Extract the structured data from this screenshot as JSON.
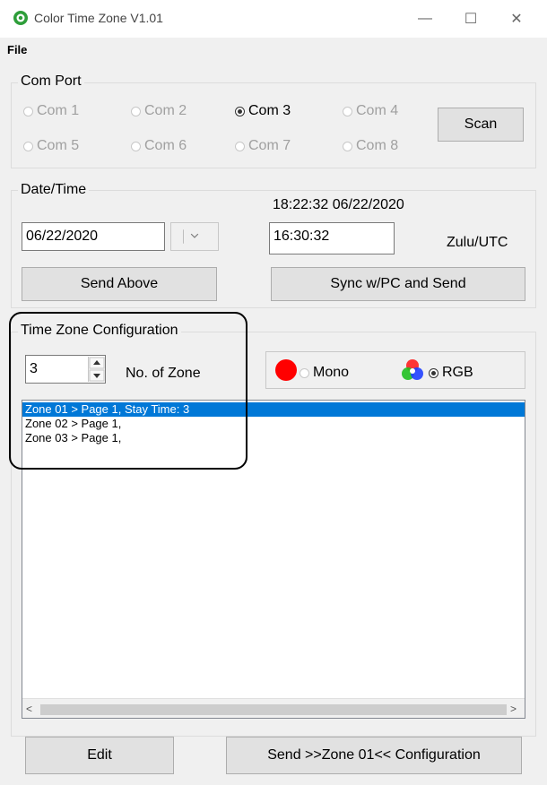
{
  "window": {
    "title": "Color Time Zone V1.01",
    "minimize_glyph": "—",
    "maximize_glyph": "☐",
    "close_glyph": "✕"
  },
  "menu": {
    "file": "File"
  },
  "com_port": {
    "title": "Com Port",
    "options": [
      "Com 1",
      "Com 2",
      "Com 3",
      "Com 4",
      "Com 5",
      "Com 6",
      "Com 7",
      "Com 8"
    ],
    "selected": "Com 3",
    "scan_label": "Scan"
  },
  "date_time": {
    "title": "Date/Time",
    "current_display": "18:22:32  06/22/2020",
    "date_value": "06/22/2020",
    "time_value": "16:30:32",
    "zone_label": "Zulu/UTC",
    "send_above_label": "Send Above",
    "sync_label": "Sync w/PC and Send"
  },
  "tz_config": {
    "title": "Time Zone Configuration",
    "zone_count": "3",
    "zone_count_label": "No. of Zone",
    "mono_label": "Mono",
    "rgb_label": "RGB",
    "selected_mode": "RGB",
    "zones": [
      "Zone 01 > Page 1, Stay Time: 3",
      "Zone 02 > Page 1,",
      "Zone 03 > Page 1,"
    ],
    "selected_zone_index": 0
  },
  "footer": {
    "edit_label": "Edit",
    "send_label": "Send >>Zone 01<< Configuration"
  },
  "colors": {
    "selection": "#0078d7",
    "mono_dot": "#ff0000"
  }
}
